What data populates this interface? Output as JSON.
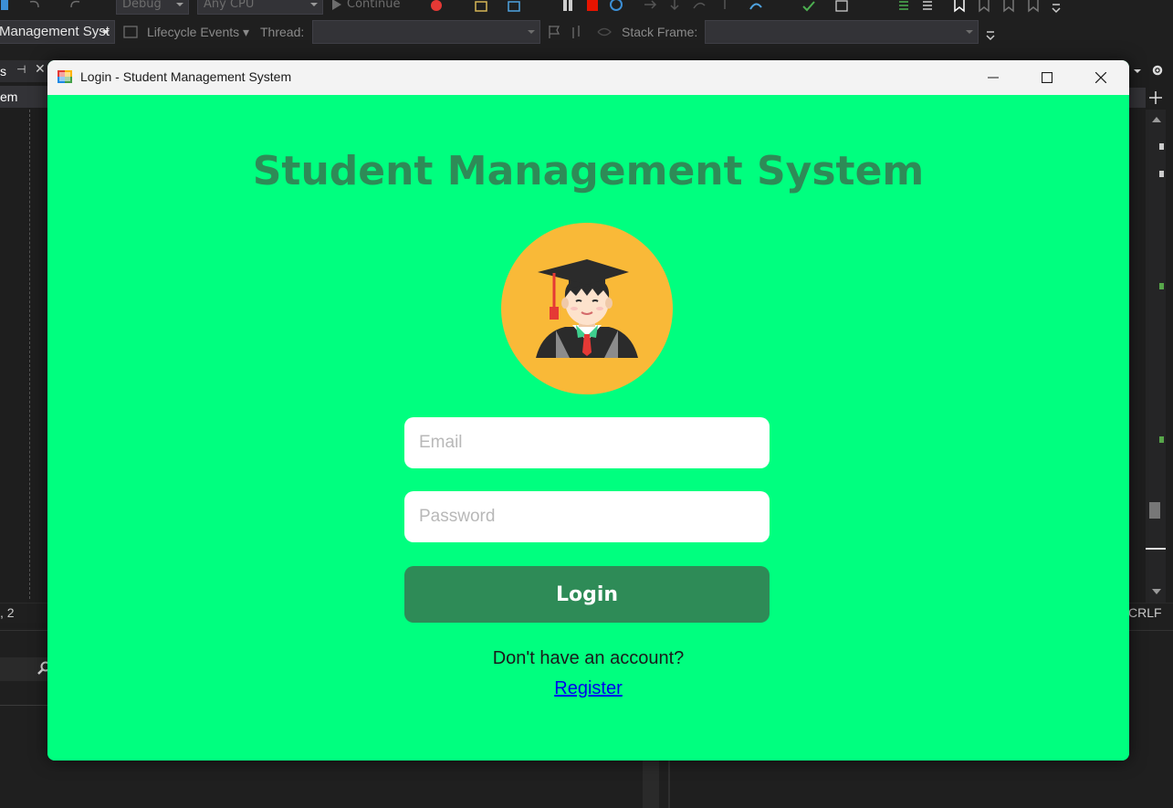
{
  "ide": {
    "toolbar": {
      "config": "Debug",
      "platform": "Any CPU",
      "continue_label": "Continue",
      "project_combo": "Management Syst",
      "lifecycle_label": "Lifecycle Events",
      "thread_label": "Thread:",
      "stack_frame_label": "Stack Frame:"
    },
    "left_tab_text": "s",
    "left_doc_text": "em",
    "status_left": ", 2",
    "status_right": "CRLF"
  },
  "window": {
    "title": "Login - Student Management System",
    "heading": "Student Management System",
    "email_placeholder": "Email",
    "password_placeholder": "Password",
    "login_label": "Login",
    "no_account_text": "Don't have an account?",
    "register_label": "Register",
    "colors": {
      "background": "#00ff7f",
      "accent": "#2e8b57",
      "avatar_bg": "#f9b938"
    },
    "avatar_icon": "graduate-student-icon"
  }
}
